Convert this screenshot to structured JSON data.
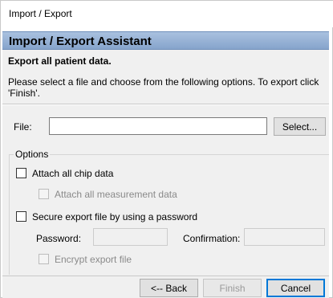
{
  "window": {
    "title": "Import / Export"
  },
  "assistant": {
    "title": "Import / Export Assistant"
  },
  "info": {
    "heading": "Export all patient data.",
    "description": "Please select a file and choose from the following options. To export click 'Finish'."
  },
  "file": {
    "label": "File:",
    "value": "",
    "select_button": "Select..."
  },
  "options": {
    "group_title": "Options",
    "attach_chip_data": {
      "label": "Attach all chip data",
      "checked": false
    },
    "attach_measurement_data": {
      "label": "Attach all measurement data",
      "checked": false,
      "enabled": false
    },
    "secure_export": {
      "label": "Secure export file by using a password",
      "checked": false
    },
    "password": {
      "label": "Password:",
      "value": ""
    },
    "confirmation": {
      "label": "Confirmation:",
      "value": ""
    },
    "encrypt": {
      "label": "Encrypt export file",
      "checked": false,
      "enabled": false
    }
  },
  "buttons": {
    "back": "<-- Back",
    "finish": "Finish",
    "cancel": "Cancel"
  }
}
